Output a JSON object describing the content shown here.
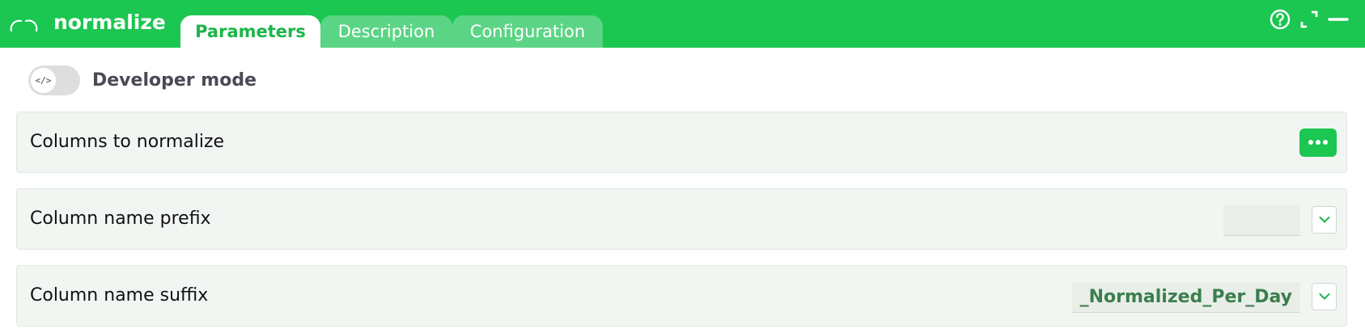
{
  "header": {
    "title": "normalize",
    "tabs": [
      {
        "label": "Parameters",
        "active": true
      },
      {
        "label": "Description",
        "active": false
      },
      {
        "label": "Configuration",
        "active": false
      }
    ],
    "icons": [
      "arc-node-icon",
      "help-icon",
      "expand-icon",
      "minimize-icon"
    ]
  },
  "developer_mode": {
    "label": "Developer mode",
    "knob_symbol": "</>",
    "enabled": false
  },
  "parameters": [
    {
      "label": "Columns to normalize",
      "control": "more-button"
    },
    {
      "label": "Column name prefix",
      "value": "",
      "control": "dropdown"
    },
    {
      "label": "Column name suffix",
      "value": "_Normalized_Per_Day",
      "control": "dropdown"
    }
  ],
  "colors": {
    "accent": "#1bc651",
    "tab_inactive": "#5bd585",
    "row_background": "#f2f6f2",
    "value_text": "#3a7f4d"
  }
}
